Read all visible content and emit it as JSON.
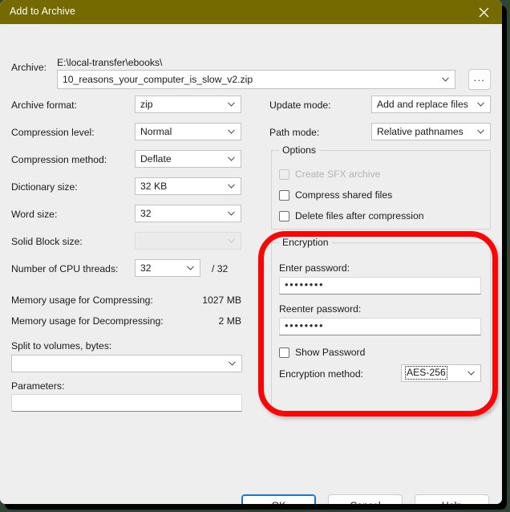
{
  "window": {
    "title": "Add to Archive",
    "close_icon": "close-icon"
  },
  "archive": {
    "label": "Archive:",
    "path": "E:\\local-transfer\\ebooks\\",
    "filename": "10_reasons_your_computer_is_slow_v2.zip",
    "browse_label": "..."
  },
  "left": {
    "archive_format": {
      "label": "Archive format:",
      "value": "zip"
    },
    "compression_level": {
      "label": "Compression level:",
      "value": "Normal"
    },
    "compression_method": {
      "label": "Compression method:",
      "value": "Deflate"
    },
    "dictionary_size": {
      "label": "Dictionary size:",
      "value": "32 KB"
    },
    "word_size": {
      "label": "Word size:",
      "value": "32"
    },
    "solid_block_size": {
      "label": "Solid Block size:",
      "value": ""
    },
    "cpu_threads": {
      "label": "Number of CPU threads:",
      "value": "32",
      "total": "/ 32"
    },
    "mem_compress": {
      "label": "Memory usage for Compressing:",
      "value": "1027 MB"
    },
    "mem_decompress": {
      "label": "Memory usage for Decompressing:",
      "value": "2 MB"
    },
    "split_volumes": {
      "label": "Split to volumes, bytes:",
      "value": ""
    },
    "parameters": {
      "label": "Parameters:",
      "value": ""
    }
  },
  "right": {
    "update_mode": {
      "label": "Update mode:",
      "value": "Add and replace files"
    },
    "path_mode": {
      "label": "Path mode:",
      "value": "Relative pathnames"
    },
    "options": {
      "title": "Options",
      "items": [
        {
          "label": "Create SFX archive",
          "checked": false,
          "disabled": true
        },
        {
          "label": "Compress shared files",
          "checked": false,
          "disabled": false
        },
        {
          "label": "Delete files after compression",
          "checked": false,
          "disabled": false
        }
      ]
    },
    "encryption": {
      "title": "Encryption",
      "enter_password_label": "Enter password:",
      "enter_password_value": "••••••••",
      "reenter_password_label": "Reenter password:",
      "reenter_password_value": "••••••••",
      "show_password_label": "Show Password",
      "show_password_checked": false,
      "method_label": "Encryption method:",
      "method_value": "AES-256"
    }
  },
  "buttons": {
    "ok": "OK",
    "cancel": "Cancel",
    "help": "Help"
  },
  "colors": {
    "titlebar": "#746a00",
    "annotation": "#fb0606",
    "default_button_border": "#1b76d2",
    "backdrop": "#2f4434"
  }
}
